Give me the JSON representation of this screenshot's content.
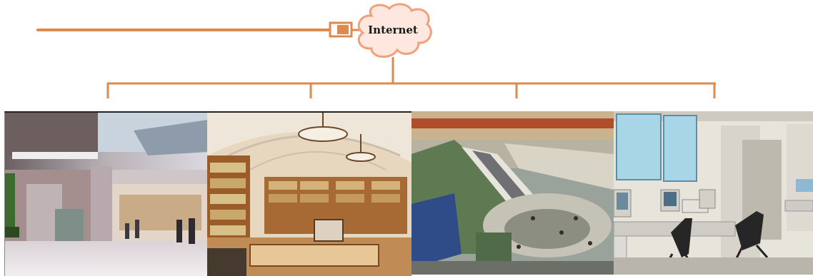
{
  "network": {
    "cloud_label": "Internet",
    "accent_color": "#de8a4e",
    "cloud_fill": "#fde7de",
    "cloud_stroke": "#f0a07a"
  },
  "photos": [
    {
      "icon": "office-lobby-photo"
    },
    {
      "icon": "library-reading-room-photo"
    },
    {
      "icon": "shopping-mall-atrium-photo"
    },
    {
      "icon": "computer-lab-photo"
    }
  ]
}
